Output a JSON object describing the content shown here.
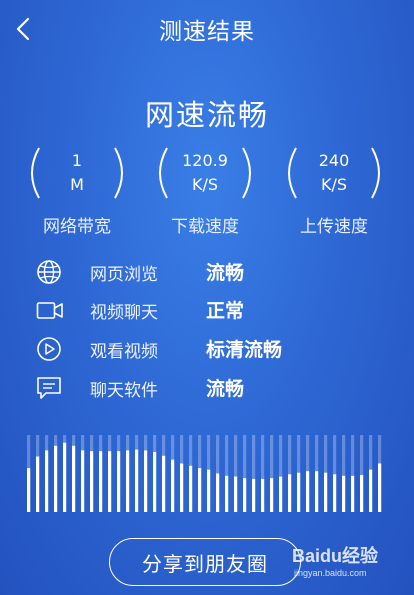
{
  "nav": {
    "title": "测速结果"
  },
  "result": {
    "title": "网速流畅"
  },
  "metrics": [
    {
      "line1": "1",
      "line2": "M",
      "label": "网络带宽"
    },
    {
      "line1": "120.9",
      "line2": "K/S",
      "label": "下载速度"
    },
    {
      "line1": "240",
      "line2": "K/S",
      "label": "上传速度"
    }
  ],
  "usage": [
    {
      "icon": "globe-icon",
      "label": "网页浏览",
      "status": "流畅"
    },
    {
      "icon": "video-camera-icon",
      "label": "视频聊天",
      "status": "正常"
    },
    {
      "icon": "play-circle-icon",
      "label": "观看视频",
      "status": "标清流畅"
    },
    {
      "icon": "chat-bubble-icon",
      "label": "聊天软件",
      "status": "流畅"
    }
  ],
  "chart_data": {
    "type": "bar",
    "values": [
      0.57,
      0.72,
      0.8,
      0.86,
      0.9,
      0.86,
      0.8,
      0.79,
      0.79,
      0.79,
      0.79,
      0.8,
      0.81,
      0.8,
      0.78,
      0.73,
      0.68,
      0.63,
      0.6,
      0.57,
      0.55,
      0.5,
      0.47,
      0.46,
      0.44,
      0.43,
      0.43,
      0.44,
      0.46,
      0.49,
      0.51,
      0.53,
      0.53,
      0.51,
      0.49,
      0.47,
      0.47,
      0.48,
      0.55,
      0.63
    ],
    "ylim": [
      0,
      1
    ],
    "color": "#ffffff"
  },
  "share": {
    "label": "分享到朋友圈"
  },
  "watermark": {
    "logo": "Baidu经验",
    "url": "jingyan.baidu.com"
  }
}
